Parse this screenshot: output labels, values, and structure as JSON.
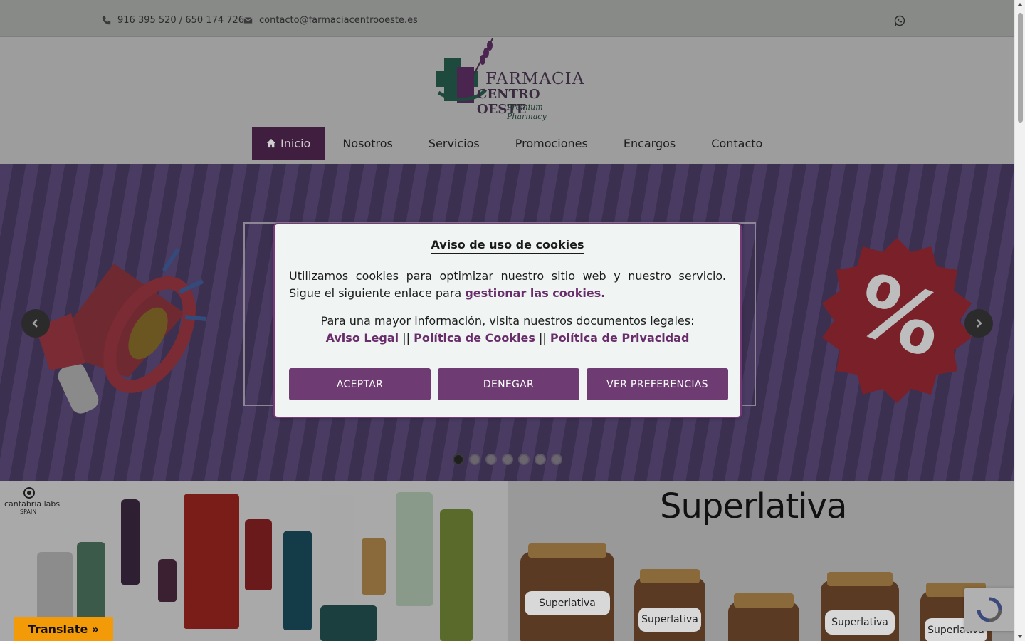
{
  "topbar": {
    "phone": "916 395 520 / 650 174 726",
    "email": "contacto@farmaciacentrooeste.es"
  },
  "logo": {
    "line1": "FARMACIA",
    "line2": "CENTRO OESTE",
    "line3": "Premium Pharmacy"
  },
  "nav": {
    "items": [
      {
        "label": "Inicio",
        "active": true
      },
      {
        "label": "Nosotros"
      },
      {
        "label": "Servicios"
      },
      {
        "label": "Promociones"
      },
      {
        "label": "Encargos"
      },
      {
        "label": "Contacto"
      }
    ]
  },
  "slider": {
    "slide_count": 7,
    "active_index": 0
  },
  "promos": {
    "left_brand": "cantabria labs",
    "left_brand_sub": "SPAIN",
    "right_brand": "Superlativa",
    "jar_label": "Superlativa"
  },
  "cookie_modal": {
    "title": "Aviso de uso de cookies",
    "text": "Utilizamos cookies para optimizar nuestro sitio web y nuestro servicio. Sigue el siguiente enlace para",
    "manage_link": "gestionar las cookies.",
    "legal_intro": "Para una mayor información, visita nuestros documentos legales:",
    "legal_links": [
      "Aviso Legal",
      "Política de Cookies",
      "Política de Privacidad"
    ],
    "separator": "||",
    "buttons": {
      "accept": "ACEPTAR",
      "deny": "DENEGAR",
      "preferences": "VER PREFERENCIAS"
    }
  },
  "translate": {
    "label": "Translate »"
  },
  "colors": {
    "brand_purple": "#6e3b72",
    "nav_active": "#3f1e40",
    "translate_orange": "#f29a07",
    "modal_bg": "#f0f5f4"
  },
  "icons": [
    "phone-icon",
    "envelope-icon",
    "whatsapp-icon",
    "home-icon",
    "chevron-left-icon",
    "chevron-right-icon",
    "recaptcha-icon"
  ]
}
